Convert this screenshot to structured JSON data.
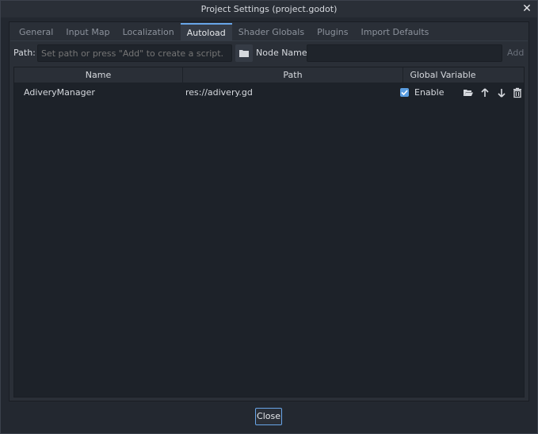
{
  "window": {
    "title": "Project Settings (project.godot)"
  },
  "tabs": [
    {
      "label": "General"
    },
    {
      "label": "Input Map"
    },
    {
      "label": "Localization"
    },
    {
      "label": "Autoload"
    },
    {
      "label": "Shader Globals"
    },
    {
      "label": "Plugins"
    },
    {
      "label": "Import Defaults"
    }
  ],
  "active_tab": "Autoload",
  "autoload": {
    "path_label": "Path:",
    "path_placeholder": "Set path or press \"Add\" to create a script.",
    "node_name_label": "Node Name:",
    "node_name_value": "",
    "add_label": "Add",
    "columns": {
      "name": "Name",
      "path": "Path",
      "global": "Global Variable"
    },
    "rows": [
      {
        "name": "AdiveryManager",
        "path": "res://adivery.gd",
        "enable_label": "Enable",
        "enabled": true
      }
    ]
  },
  "footer": {
    "close_label": "Close"
  },
  "colors": {
    "accent": "#68a5e8",
    "checkbox": "#5a9de0"
  },
  "icons": [
    "close-icon",
    "folder-icon",
    "open-folder-icon",
    "move-up-icon",
    "move-down-icon",
    "trash-icon",
    "checkmark-icon"
  ]
}
